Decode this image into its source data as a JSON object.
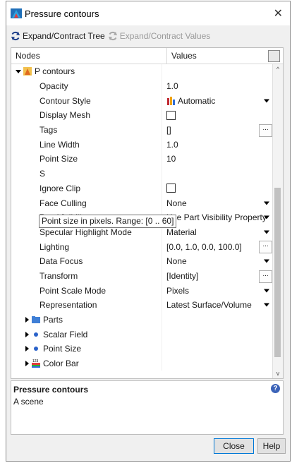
{
  "window": {
    "title": "Pressure contours"
  },
  "toolbar": {
    "expand_tree": "Expand/Contract Tree",
    "expand_values": "Expand/Contract Values"
  },
  "columns": {
    "nodes": "Nodes",
    "values": "Values"
  },
  "root": {
    "label": "P contours"
  },
  "properties": [
    {
      "name": "Opacity",
      "value": "1.0",
      "control": "text"
    },
    {
      "name": "Contour Style",
      "value": "Automatic",
      "control": "dropdown",
      "icon": "contour-style-icon"
    },
    {
      "name": "Display Mesh",
      "value": "",
      "control": "checkbox"
    },
    {
      "name": "Tags",
      "value": "[]",
      "control": "ellipsis"
    },
    {
      "name": "Line Width",
      "value": "1.0",
      "control": "text"
    },
    {
      "name": "Point Size",
      "value": "10",
      "control": "text"
    },
    {
      "name": "S",
      "value": "",
      "control": "text"
    },
    {
      "name": "Ignore Clip",
      "value": "",
      "control": "checkbox"
    },
    {
      "name": "Face Culling",
      "value": "None",
      "control": "dropdown"
    },
    {
      "name": "Part Visibility",
      "value": "Use Part Visibility Property",
      "control": "dropdown"
    },
    {
      "name": "Specular Highlight Mode",
      "value": "Material",
      "control": "dropdown"
    },
    {
      "name": "Lighting",
      "value": "[0.0, 1.0, 0.0, 100.0]",
      "control": "ellipsis"
    },
    {
      "name": "Data Focus",
      "value": "None",
      "control": "dropdown"
    },
    {
      "name": "Transform",
      "value": "[Identity]",
      "control": "ellipsis"
    },
    {
      "name": "Point Scale Mode",
      "value": "Pixels",
      "control": "dropdown"
    },
    {
      "name": "Representation",
      "value": "Latest Surface/Volume",
      "control": "dropdown"
    }
  ],
  "children": [
    {
      "label": "Parts",
      "icon": "folder-icon"
    },
    {
      "label": "Scalar Field",
      "icon": "dot-icon"
    },
    {
      "label": "Point Size",
      "icon": "dot-icon"
    },
    {
      "label": "Color Bar",
      "icon": "color-bar-icon"
    }
  ],
  "tooltip": "Point size in pixels. Range: [0 .. 60]",
  "description": {
    "title": "Pressure contours",
    "body": "A scene"
  },
  "buttons": {
    "close": "Close",
    "help": "Help"
  },
  "colors": {
    "accent": "#0078d7",
    "help_icon": "#3b63b8",
    "folder": "#3f7fd6",
    "dot": "#2a62c9"
  }
}
